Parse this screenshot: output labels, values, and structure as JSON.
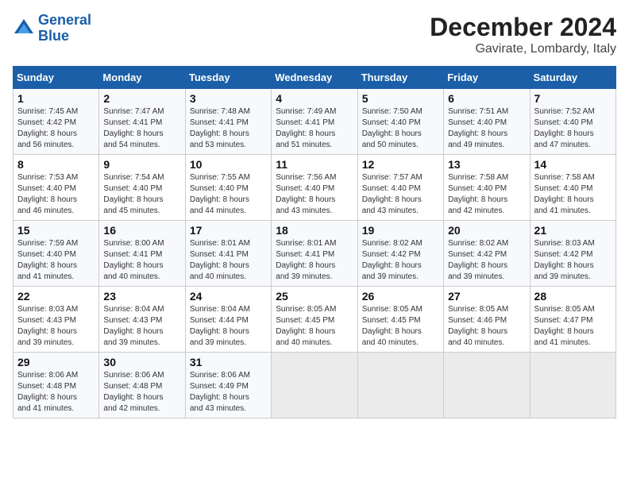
{
  "header": {
    "logo_line1": "General",
    "logo_line2": "Blue",
    "title": "December 2024",
    "subtitle": "Gavirate, Lombardy, Italy"
  },
  "calendar": {
    "weekdays": [
      "Sunday",
      "Monday",
      "Tuesday",
      "Wednesday",
      "Thursday",
      "Friday",
      "Saturday"
    ],
    "weeks": [
      [
        {
          "day": "1",
          "info": "Sunrise: 7:45 AM\nSunset: 4:42 PM\nDaylight: 8 hours\nand 56 minutes."
        },
        {
          "day": "2",
          "info": "Sunrise: 7:47 AM\nSunset: 4:41 PM\nDaylight: 8 hours\nand 54 minutes."
        },
        {
          "day": "3",
          "info": "Sunrise: 7:48 AM\nSunset: 4:41 PM\nDaylight: 8 hours\nand 53 minutes."
        },
        {
          "day": "4",
          "info": "Sunrise: 7:49 AM\nSunset: 4:41 PM\nDaylight: 8 hours\nand 51 minutes."
        },
        {
          "day": "5",
          "info": "Sunrise: 7:50 AM\nSunset: 4:40 PM\nDaylight: 8 hours\nand 50 minutes."
        },
        {
          "day": "6",
          "info": "Sunrise: 7:51 AM\nSunset: 4:40 PM\nDaylight: 8 hours\nand 49 minutes."
        },
        {
          "day": "7",
          "info": "Sunrise: 7:52 AM\nSunset: 4:40 PM\nDaylight: 8 hours\nand 47 minutes."
        }
      ],
      [
        {
          "day": "8",
          "info": "Sunrise: 7:53 AM\nSunset: 4:40 PM\nDaylight: 8 hours\nand 46 minutes."
        },
        {
          "day": "9",
          "info": "Sunrise: 7:54 AM\nSunset: 4:40 PM\nDaylight: 8 hours\nand 45 minutes."
        },
        {
          "day": "10",
          "info": "Sunrise: 7:55 AM\nSunset: 4:40 PM\nDaylight: 8 hours\nand 44 minutes."
        },
        {
          "day": "11",
          "info": "Sunrise: 7:56 AM\nSunset: 4:40 PM\nDaylight: 8 hours\nand 43 minutes."
        },
        {
          "day": "12",
          "info": "Sunrise: 7:57 AM\nSunset: 4:40 PM\nDaylight: 8 hours\nand 43 minutes."
        },
        {
          "day": "13",
          "info": "Sunrise: 7:58 AM\nSunset: 4:40 PM\nDaylight: 8 hours\nand 42 minutes."
        },
        {
          "day": "14",
          "info": "Sunrise: 7:58 AM\nSunset: 4:40 PM\nDaylight: 8 hours\nand 41 minutes."
        }
      ],
      [
        {
          "day": "15",
          "info": "Sunrise: 7:59 AM\nSunset: 4:40 PM\nDaylight: 8 hours\nand 41 minutes."
        },
        {
          "day": "16",
          "info": "Sunrise: 8:00 AM\nSunset: 4:41 PM\nDaylight: 8 hours\nand 40 minutes."
        },
        {
          "day": "17",
          "info": "Sunrise: 8:01 AM\nSunset: 4:41 PM\nDaylight: 8 hours\nand 40 minutes."
        },
        {
          "day": "18",
          "info": "Sunrise: 8:01 AM\nSunset: 4:41 PM\nDaylight: 8 hours\nand 39 minutes."
        },
        {
          "day": "19",
          "info": "Sunrise: 8:02 AM\nSunset: 4:42 PM\nDaylight: 8 hours\nand 39 minutes."
        },
        {
          "day": "20",
          "info": "Sunrise: 8:02 AM\nSunset: 4:42 PM\nDaylight: 8 hours\nand 39 minutes."
        },
        {
          "day": "21",
          "info": "Sunrise: 8:03 AM\nSunset: 4:42 PM\nDaylight: 8 hours\nand 39 minutes."
        }
      ],
      [
        {
          "day": "22",
          "info": "Sunrise: 8:03 AM\nSunset: 4:43 PM\nDaylight: 8 hours\nand 39 minutes."
        },
        {
          "day": "23",
          "info": "Sunrise: 8:04 AM\nSunset: 4:43 PM\nDaylight: 8 hours\nand 39 minutes."
        },
        {
          "day": "24",
          "info": "Sunrise: 8:04 AM\nSunset: 4:44 PM\nDaylight: 8 hours\nand 39 minutes."
        },
        {
          "day": "25",
          "info": "Sunrise: 8:05 AM\nSunset: 4:45 PM\nDaylight: 8 hours\nand 40 minutes."
        },
        {
          "day": "26",
          "info": "Sunrise: 8:05 AM\nSunset: 4:45 PM\nDaylight: 8 hours\nand 40 minutes."
        },
        {
          "day": "27",
          "info": "Sunrise: 8:05 AM\nSunset: 4:46 PM\nDaylight: 8 hours\nand 40 minutes."
        },
        {
          "day": "28",
          "info": "Sunrise: 8:05 AM\nSunset: 4:47 PM\nDaylight: 8 hours\nand 41 minutes."
        }
      ],
      [
        {
          "day": "29",
          "info": "Sunrise: 8:06 AM\nSunset: 4:48 PM\nDaylight: 8 hours\nand 41 minutes."
        },
        {
          "day": "30",
          "info": "Sunrise: 8:06 AM\nSunset: 4:48 PM\nDaylight: 8 hours\nand 42 minutes."
        },
        {
          "day": "31",
          "info": "Sunrise: 8:06 AM\nSunset: 4:49 PM\nDaylight: 8 hours\nand 43 minutes."
        },
        {
          "day": "",
          "info": ""
        },
        {
          "day": "",
          "info": ""
        },
        {
          "day": "",
          "info": ""
        },
        {
          "day": "",
          "info": ""
        }
      ]
    ]
  }
}
